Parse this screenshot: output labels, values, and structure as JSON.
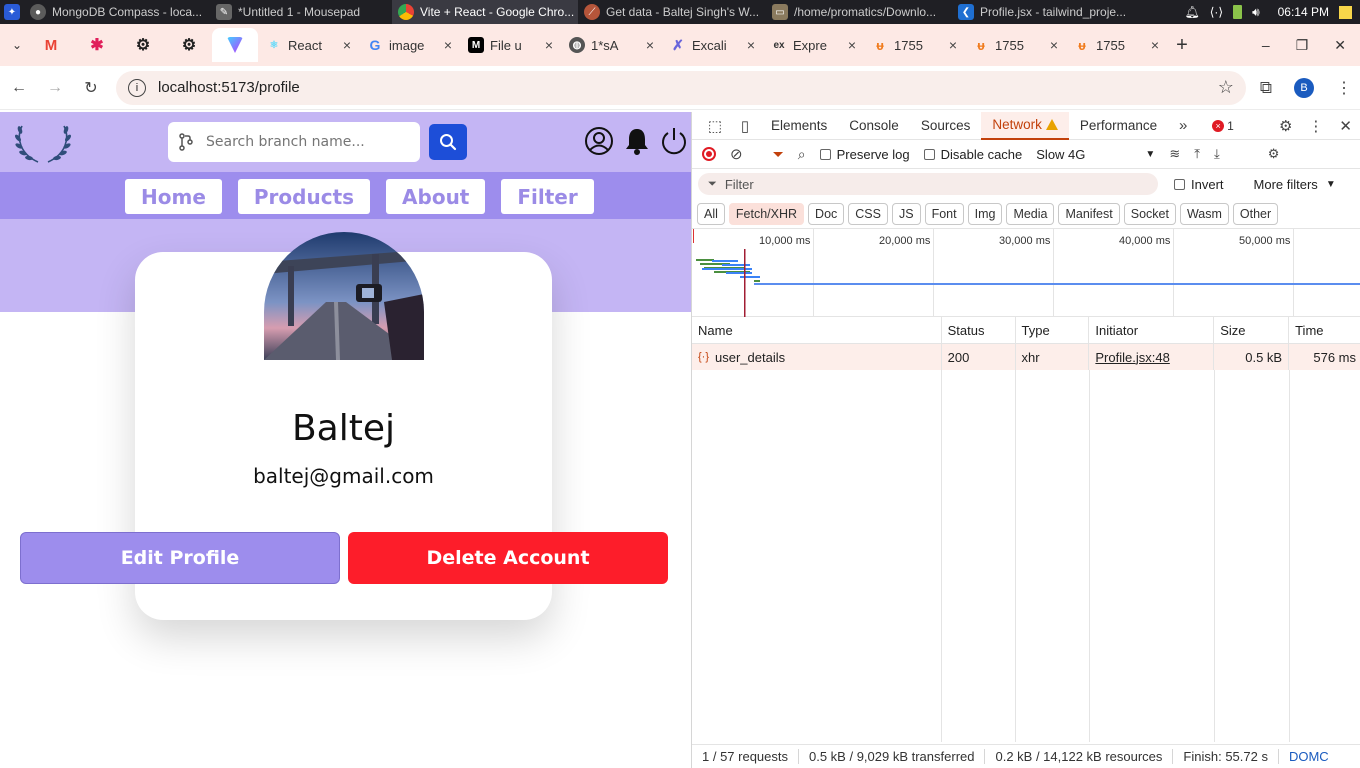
{
  "taskbar": {
    "windows": [
      {
        "label": "MongoDB Compass - loca...",
        "icon": "mongodb-icon",
        "color": "#5b5b5b"
      },
      {
        "label": "*Untitled 1 - Mousepad",
        "icon": "mousepad-icon",
        "color": "#666666"
      },
      {
        "label": "Vite + React - Google Chro...",
        "icon": "chrome-icon",
        "color": "#1a73e8"
      },
      {
        "label": "Get data - Baltej Singh's W...",
        "icon": "postman-icon",
        "color": "#b5553a"
      },
      {
        "label": "/home/promatics/Downlo...",
        "icon": "folder-icon",
        "color": "#8a7a5e"
      },
      {
        "label": "Profile.jsx - tailwind_proje...",
        "icon": "vscode-icon",
        "color": "#1f6fd1"
      }
    ],
    "clock": "06:14 PM"
  },
  "tabs": {
    "items": [
      {
        "label": "React",
        "icon": "react-icon",
        "color": "#61dafb"
      },
      {
        "label": "image",
        "icon": "google-icon",
        "color": "#4285f4"
      },
      {
        "label": "File u",
        "icon": "medium-icon",
        "color": "#000000"
      },
      {
        "label": "1*sA",
        "icon": "globe-icon",
        "color": "#555555"
      },
      {
        "label": "Excali",
        "icon": "excalidraw-icon",
        "color": "#6965db"
      },
      {
        "label": "Expre",
        "icon": "express-icon",
        "color": "#333333"
      },
      {
        "label": "1755",
        "icon": "upwork-icon",
        "color": "#f07b1d"
      },
      {
        "label": "1755",
        "icon": "upwork-icon",
        "color": "#f07b1d"
      },
      {
        "label": "1755",
        "icon": "upwork-icon",
        "color": "#f07b1d"
      }
    ]
  },
  "browser": {
    "url": "localhost:5173/profile",
    "profile_initial": "B"
  },
  "app": {
    "search_placeholder": "Search branch name...",
    "nav": [
      "Home",
      "Products",
      "About",
      "Filter"
    ],
    "user_name": "Baltej",
    "user_email": "baltej@gmail.com",
    "edit_label": "Edit Profile",
    "delete_label": "Delete Account",
    "colors": {
      "header": "#c4b5f4",
      "nav_band": "#9d8ded",
      "search_button": "#1d4ed8",
      "delete": "#fd1d2a"
    }
  },
  "devtools": {
    "panels": [
      "Elements",
      "Console",
      "Sources",
      "Network",
      "Performance"
    ],
    "active_panel": "Network",
    "error_count": "1",
    "preserve_log": "Preserve log",
    "disable_cache": "Disable cache",
    "throttle": "Slow 4G",
    "filter_placeholder": "Filter",
    "invert": "Invert",
    "more_filters": "More filters",
    "types": [
      "All",
      "Fetch/XHR",
      "Doc",
      "CSS",
      "JS",
      "Font",
      "Img",
      "Media",
      "Manifest",
      "Socket",
      "Wasm",
      "Other"
    ],
    "active_type": "Fetch/XHR",
    "timeline_ticks": [
      "10,000 ms",
      "20,000 ms",
      "30,000 ms",
      "40,000 ms",
      "50,000 ms"
    ],
    "columns": [
      "Name",
      "Status",
      "Type",
      "Initiator",
      "Size",
      "Time"
    ],
    "rows": [
      {
        "name": "user_details",
        "status": "200",
        "type": "xhr",
        "initiator": "Profile.jsx:48",
        "size": "0.5 kB",
        "time": "576 ms"
      }
    ],
    "status": {
      "requests": "1 / 57 requests",
      "transferred": "0.5 kB / 9,029 kB transferred",
      "resources": "0.2 kB / 14,122 kB resources",
      "finish": "Finish: 55.72 s",
      "domcontent": "DOMC"
    }
  }
}
